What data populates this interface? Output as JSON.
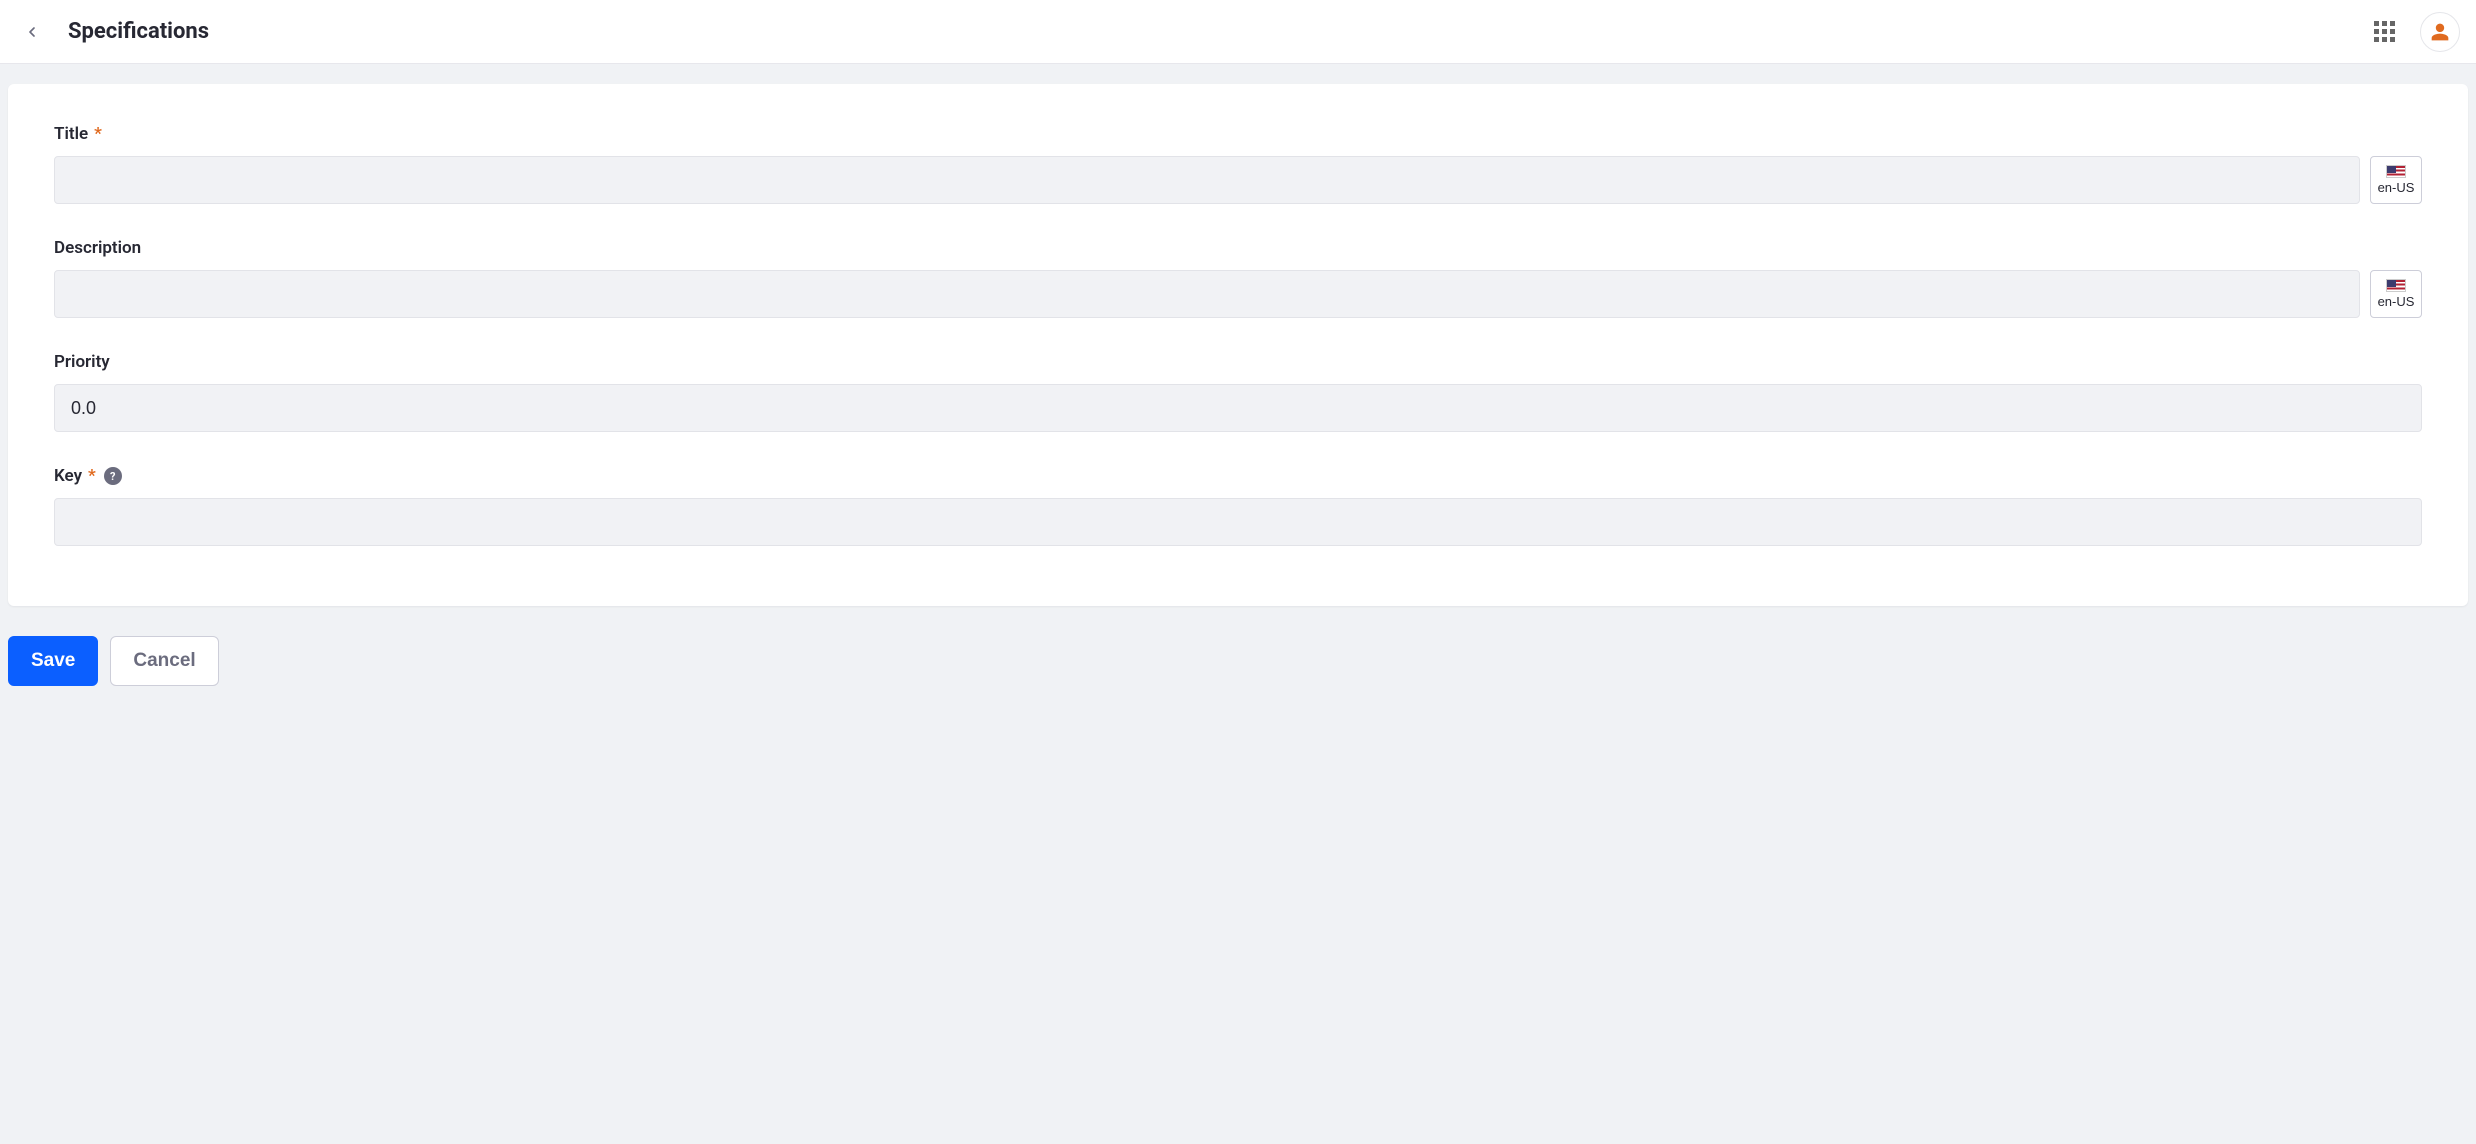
{
  "header": {
    "title": "Specifications"
  },
  "form": {
    "title": {
      "label": "Title",
      "required": true,
      "value": "",
      "locale": "en-US"
    },
    "description": {
      "label": "Description",
      "required": false,
      "value": "",
      "locale": "en-US"
    },
    "priority": {
      "label": "Priority",
      "required": false,
      "value": "0.0"
    },
    "key": {
      "label": "Key",
      "required": true,
      "value": "",
      "help": "?"
    }
  },
  "footer": {
    "save_label": "Save",
    "cancel_label": "Cancel"
  }
}
